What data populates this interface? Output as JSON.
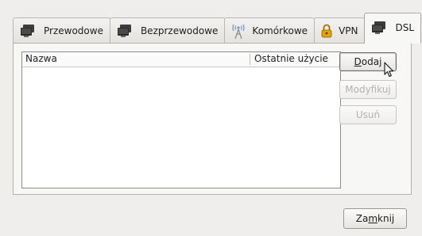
{
  "tabs": [
    {
      "label": "Przewodowe",
      "icon": "wired-network-icon",
      "active": false
    },
    {
      "label": "Bezprzewodowe",
      "icon": "wireless-network-icon",
      "active": false
    },
    {
      "label": "Komórkowe",
      "icon": "mobile-antenna-icon",
      "active": false
    },
    {
      "label": "VPN",
      "icon": "vpn-lock-icon",
      "active": false
    },
    {
      "label": "DSL",
      "icon": "dsl-network-icon",
      "active": true
    }
  ],
  "list": {
    "columns": [
      "Nazwa",
      "Ostatnie użycie"
    ],
    "rows": []
  },
  "buttons": {
    "add": {
      "before": "",
      "mnemonic": "D",
      "after": "odaj"
    },
    "modify": "Modyfikuj",
    "delete": "Usuń",
    "close": {
      "before": "Za",
      "mnemonic": "m",
      "after": "knij"
    }
  },
  "colors": {
    "window_bg": "#efeeec",
    "panel_bg": "#f7f7f6",
    "list_bg": "#ffffff",
    "vpn_icon": "#e1a400"
  }
}
